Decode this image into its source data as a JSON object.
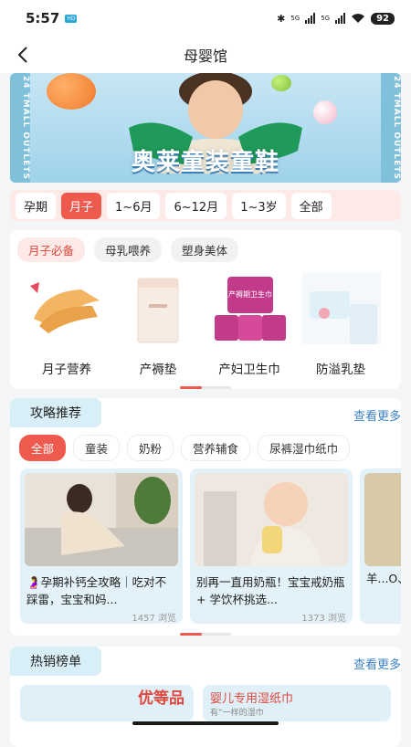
{
  "status": {
    "time": "5:57",
    "hd": "HD",
    "net1": "5G",
    "net2": "5G",
    "battery": "92"
  },
  "header": {
    "title": "母婴馆"
  },
  "banner": {
    "text": "奥莱童装童鞋",
    "side_left": "24 TMALL OUTLETS",
    "side_right": "24 TMALL OUTLETS"
  },
  "stage_tabs": [
    "孕期",
    "月子",
    "1~6月",
    "6~12月",
    "1~3岁",
    "全部"
  ],
  "category": {
    "sub_tabs": [
      "月子必备",
      "母乳喂养",
      "塑身美体"
    ],
    "products": [
      {
        "name": "月子营养"
      },
      {
        "name": "产褥垫"
      },
      {
        "name": "产妇卫生巾",
        "pack_text": "产褥期卫生巾"
      },
      {
        "name": "防溢乳垫"
      }
    ]
  },
  "articles_section": {
    "title": "攻略推荐",
    "more": "查看更多",
    "tabs": [
      "全部",
      "童装",
      "奶粉",
      "营养辅食",
      "尿裤湿巾纸巾"
    ],
    "items": [
      {
        "title": "🤰孕期补钙全攻略｜吃对不踩雷，宝宝和妈...",
        "views": "1457 浏览"
      },
      {
        "title": "别再一直用奶瓶！宝宝戒奶瓶 + 学饮杯挑选...",
        "views": "1373 浏览"
      },
      {
        "title": "羊...O、",
        "views": ""
      }
    ]
  },
  "hot_section": {
    "title": "热销榜单",
    "more": "查看更多",
    "card1_text": "优等品",
    "card2_text": "婴儿专用湿纸巾",
    "card2_sub": "有“一样的湿巾"
  },
  "colors": {
    "accent": "#ef5a4f",
    "link": "#3a80c5",
    "section_bg": "#d9eff7"
  }
}
